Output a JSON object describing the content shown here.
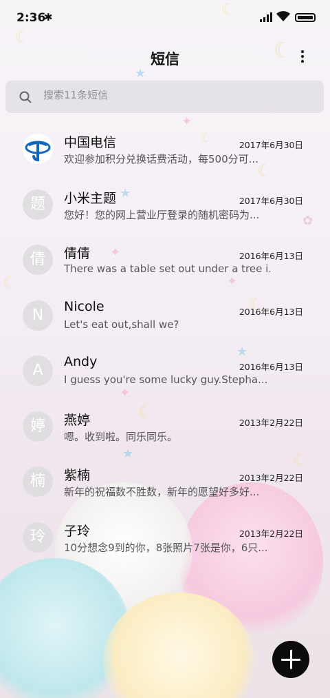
{
  "status_bar": {
    "time": "2:36"
  },
  "header": {
    "title": "短信"
  },
  "search": {
    "placeholder": "搜索11条短信"
  },
  "messages": [
    {
      "sender": "中国电信",
      "date": "2017年6月30日",
      "preview": "欢迎参加积分兑换话费活动，每500分可...",
      "avatar": "",
      "avatar_type": "logo"
    },
    {
      "sender": "小米主题",
      "date": "2017年6月30日",
      "preview": "您好！您的网上营业厅登录的随机密码为...",
      "avatar": "题",
      "avatar_type": "initial"
    },
    {
      "sender": "倩倩",
      "date": "2016年6月13日",
      "preview": "There was a table set out under a tree i...",
      "avatar": "倩",
      "avatar_type": "initial"
    },
    {
      "sender": "Nicole",
      "date": "2016年6月13日",
      "preview": "Let's eat out,shall we?",
      "avatar": "N",
      "avatar_type": "initial"
    },
    {
      "sender": "Andy",
      "date": "2016年6月13日",
      "preview": "I guess you're some lucky guy.Stepha...",
      "avatar": "A",
      "avatar_type": "initial"
    },
    {
      "sender": "燕婷",
      "date": "2013年2月22日",
      "preview": "嗯。收到啦。同乐同乐。",
      "avatar": "婷",
      "avatar_type": "initial"
    },
    {
      "sender": "紫楠",
      "date": "2013年2月22日",
      "preview": "新年的祝福数不胜数，新年的愿望好多好...",
      "avatar": "楠",
      "avatar_type": "initial"
    },
    {
      "sender": "子玲",
      "date": "2013年2月22日",
      "preview": "10分想念9到的你，8张照片7张是你，6只...",
      "avatar": "玲",
      "avatar_type": "initial"
    }
  ],
  "icons": {
    "bluetooth": "bluetooth-icon",
    "signal": "signal-icon",
    "wifi": "wifi-icon",
    "battery": "battery-icon",
    "search": "search-icon",
    "more": "more-vertical-icon",
    "compose": "plus-icon"
  },
  "colors": {
    "fab": "#0c0c0c",
    "avatar_bg": "#dedce0",
    "telecom_blue": "#1366b6"
  }
}
